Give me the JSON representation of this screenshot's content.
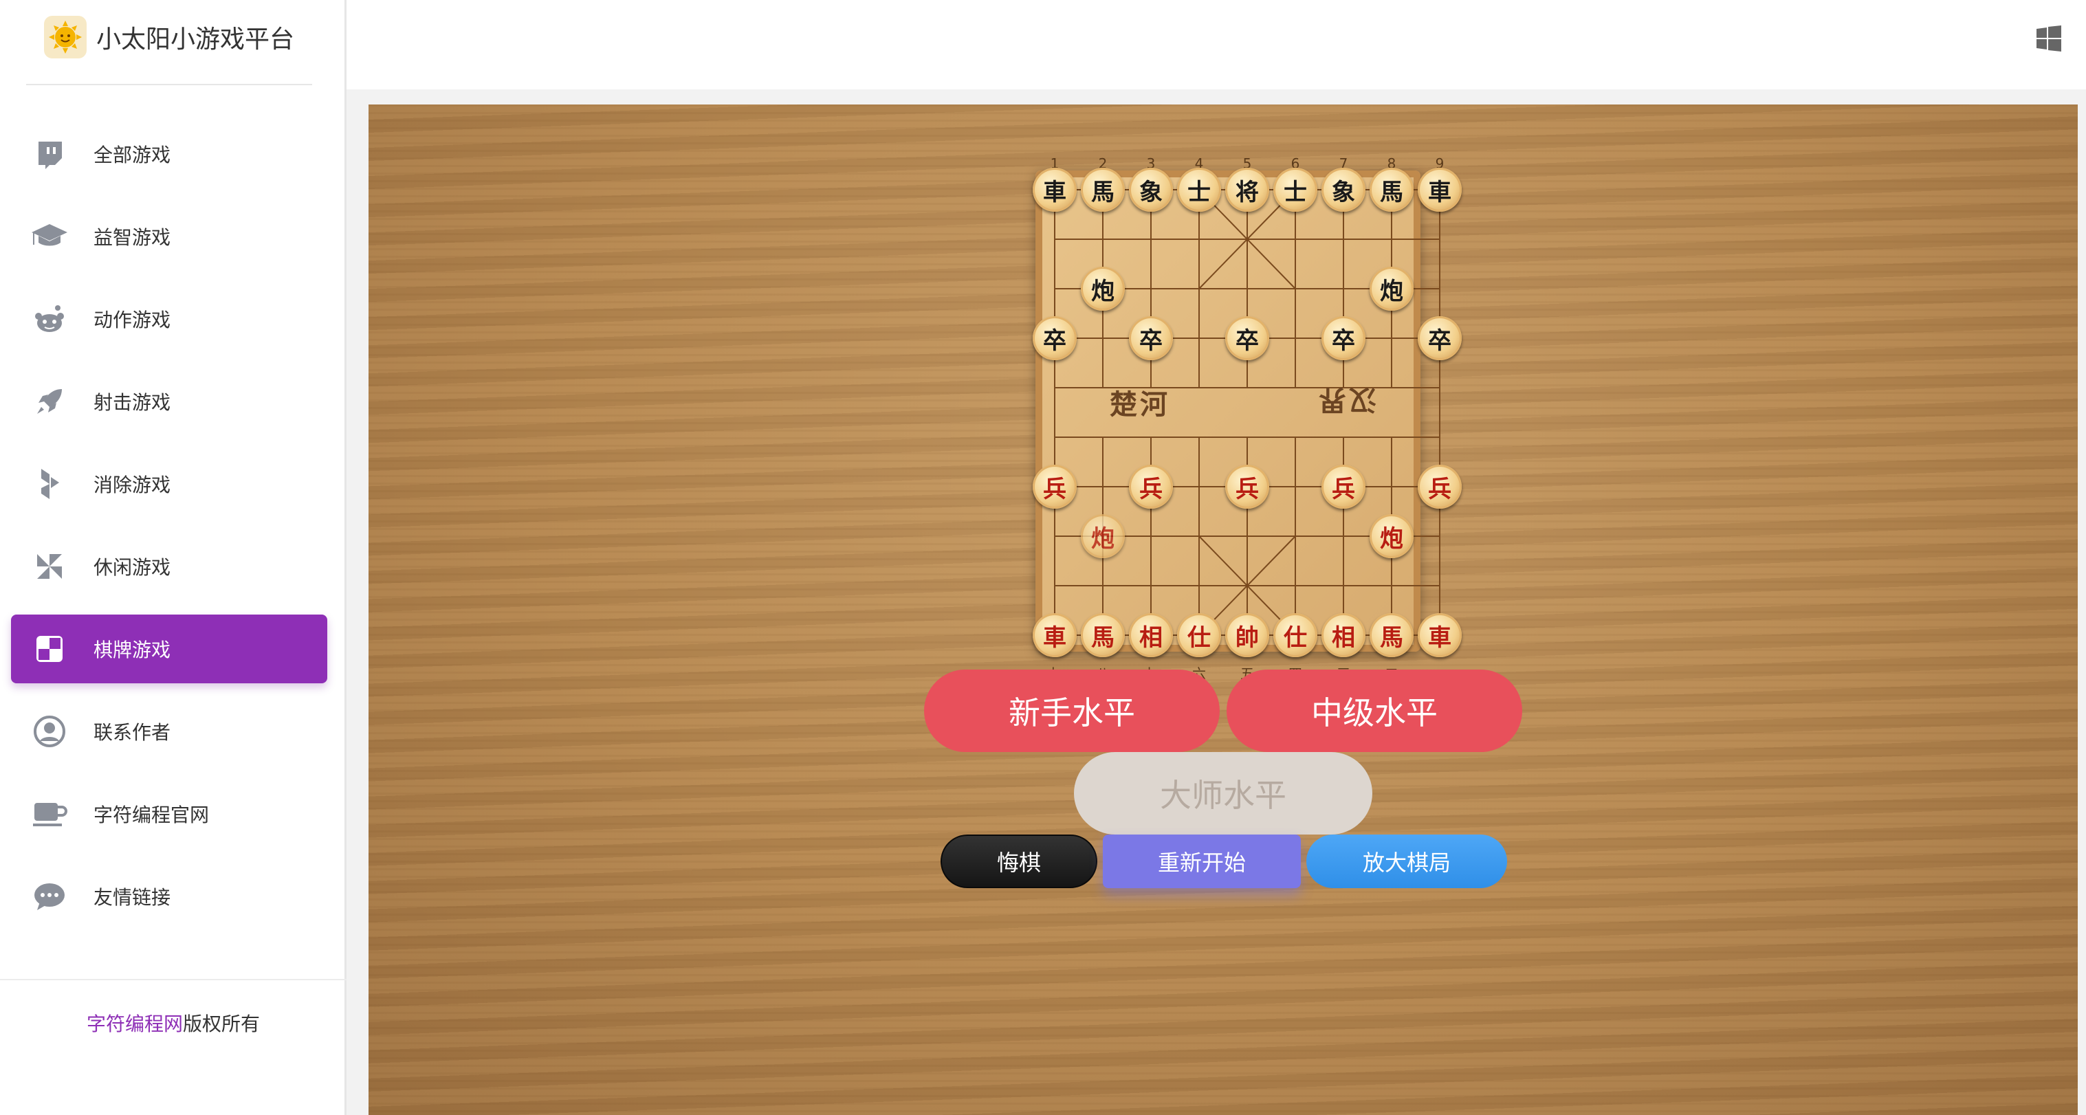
{
  "brand": {
    "title": "小太阳小游戏平台",
    "logo_icon": "sun-logo-icon"
  },
  "sidebar": {
    "items": [
      {
        "label": "全部游戏",
        "icon": "twitch-icon",
        "active": false
      },
      {
        "label": "益智游戏",
        "icon": "graduation-cap-icon",
        "active": false
      },
      {
        "label": "动作游戏",
        "icon": "reddit-icon",
        "active": false
      },
      {
        "label": "射击游戏",
        "icon": "rocket-icon",
        "active": false
      },
      {
        "label": "消除游戏",
        "icon": "hubspot-icon",
        "active": false
      },
      {
        "label": "休闲游戏",
        "icon": "pinwheel-icon",
        "active": false
      },
      {
        "label": "棋牌游戏",
        "icon": "checkerboard-icon",
        "active": true
      },
      {
        "label": "联系作者",
        "icon": "user-circle-icon",
        "active": false
      },
      {
        "label": "字符编程官网",
        "icon": "coffee-cup-icon",
        "active": false
      },
      {
        "label": "友情链接",
        "icon": "chat-bubble-icon",
        "active": false
      }
    ],
    "footer": {
      "brand": "字符编程网",
      "suffix": "版权所有"
    }
  },
  "header": {
    "right_icon": "windows-icon"
  },
  "colors": {
    "accent": "#8e2fb6",
    "level_button": "#e8505b",
    "restart": "#7b78e6",
    "enlarge": "#2f8fe8"
  },
  "board": {
    "top_numbers": [
      "1",
      "2",
      "3",
      "4",
      "5",
      "6",
      "7",
      "8",
      "9"
    ],
    "bottom_numbers": [
      "九",
      "八",
      "七",
      "六",
      "五",
      "四",
      "三",
      "二",
      "一"
    ],
    "river_left": "楚河",
    "river_right": "汉界",
    "pieces": [
      {
        "t": "車",
        "s": "black",
        "c": 0,
        "r": 0
      },
      {
        "t": "馬",
        "s": "black",
        "c": 1,
        "r": 0
      },
      {
        "t": "象",
        "s": "black",
        "c": 2,
        "r": 0
      },
      {
        "t": "士",
        "s": "black",
        "c": 3,
        "r": 0
      },
      {
        "t": "将",
        "s": "black",
        "c": 4,
        "r": 0
      },
      {
        "t": "士",
        "s": "black",
        "c": 5,
        "r": 0
      },
      {
        "t": "象",
        "s": "black",
        "c": 6,
        "r": 0
      },
      {
        "t": "馬",
        "s": "black",
        "c": 7,
        "r": 0
      },
      {
        "t": "車",
        "s": "black",
        "c": 8,
        "r": 0
      },
      {
        "t": "炮",
        "s": "black",
        "c": 1,
        "r": 2
      },
      {
        "t": "炮",
        "s": "black",
        "c": 7,
        "r": 2
      },
      {
        "t": "卒",
        "s": "black",
        "c": 0,
        "r": 3
      },
      {
        "t": "卒",
        "s": "black",
        "c": 2,
        "r": 3
      },
      {
        "t": "卒",
        "s": "black",
        "c": 4,
        "r": 3
      },
      {
        "t": "卒",
        "s": "black",
        "c": 6,
        "r": 3
      },
      {
        "t": "卒",
        "s": "black",
        "c": 8,
        "r": 3
      },
      {
        "t": "兵",
        "s": "red",
        "c": 0,
        "r": 6
      },
      {
        "t": "兵",
        "s": "red",
        "c": 2,
        "r": 6
      },
      {
        "t": "兵",
        "s": "red",
        "c": 4,
        "r": 6
      },
      {
        "t": "兵",
        "s": "red",
        "c": 6,
        "r": 6
      },
      {
        "t": "兵",
        "s": "red",
        "c": 8,
        "r": 6
      },
      {
        "t": "炮",
        "s": "red",
        "c": 1,
        "r": 7,
        "dim": true
      },
      {
        "t": "炮",
        "s": "red",
        "c": 7,
        "r": 7
      },
      {
        "t": "車",
        "s": "red",
        "c": 0,
        "r": 9
      },
      {
        "t": "馬",
        "s": "red",
        "c": 1,
        "r": 9
      },
      {
        "t": "相",
        "s": "red",
        "c": 2,
        "r": 9
      },
      {
        "t": "仕",
        "s": "red",
        "c": 3,
        "r": 9
      },
      {
        "t": "帥",
        "s": "red",
        "c": 4,
        "r": 9
      },
      {
        "t": "仕",
        "s": "red",
        "c": 5,
        "r": 9
      },
      {
        "t": "相",
        "s": "red",
        "c": 6,
        "r": 9
      },
      {
        "t": "馬",
        "s": "red",
        "c": 7,
        "r": 9
      },
      {
        "t": "車",
        "s": "red",
        "c": 8,
        "r": 9
      }
    ]
  },
  "levels": {
    "novice": "新手水平",
    "intermediate": "中级水平",
    "master": "大师水平"
  },
  "controls": {
    "undo": "悔棋",
    "restart": "重新开始",
    "enlarge": "放大棋局"
  }
}
